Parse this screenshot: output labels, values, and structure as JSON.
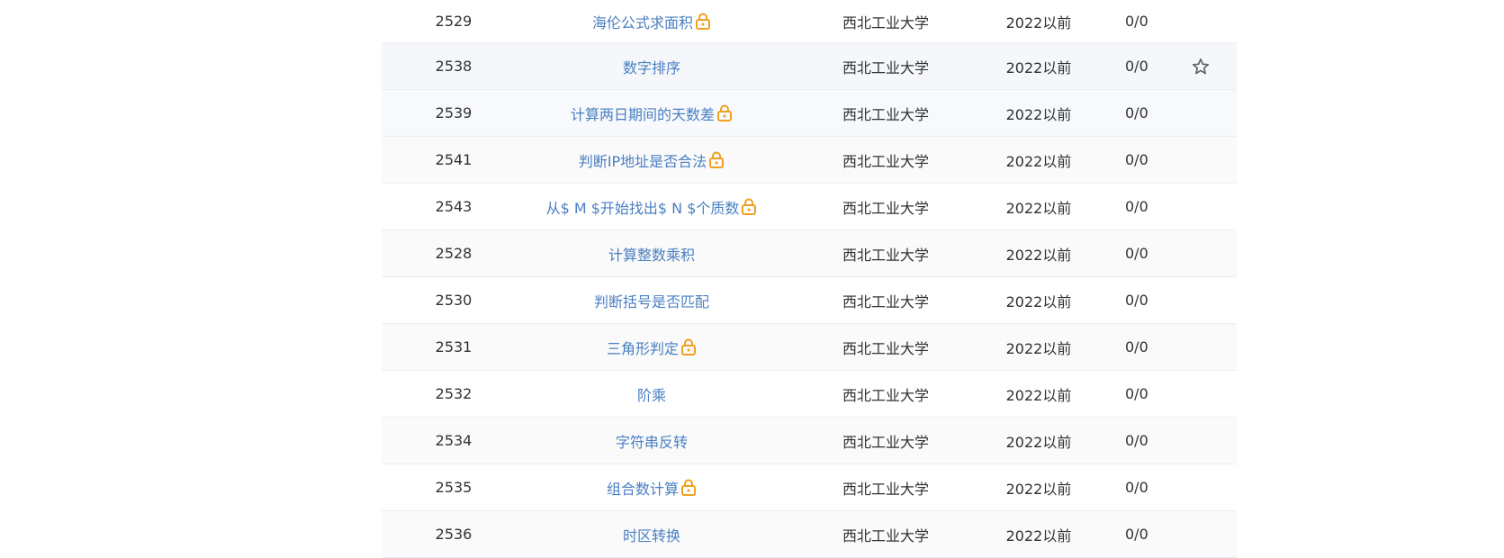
{
  "rows": [
    {
      "id": "2529",
      "title": "海伦公式求面积",
      "locked": true,
      "source": "西北工业大学",
      "year": "2022以前",
      "ratio": "0/0"
    },
    {
      "id": "2538",
      "title": "数字排序",
      "locked": false,
      "source": "西北工业大学",
      "year": "2022以前",
      "ratio": "0/0",
      "star": true
    },
    {
      "id": "2539",
      "title": "计算两日期间的天数差",
      "locked": true,
      "source": "西北工业大学",
      "year": "2022以前",
      "ratio": "0/0"
    },
    {
      "id": "2541",
      "title": "判断IP地址是否合法",
      "locked": true,
      "source": "西北工业大学",
      "year": "2022以前",
      "ratio": "0/0"
    },
    {
      "id": "2543",
      "title": "从$ M $开始找出$ N $个质数",
      "locked": true,
      "source": "西北工业大学",
      "year": "2022以前",
      "ratio": "0/0"
    },
    {
      "id": "2528",
      "title": "计算整数乘积",
      "locked": false,
      "source": "西北工业大学",
      "year": "2022以前",
      "ratio": "0/0"
    },
    {
      "id": "2530",
      "title": "判断括号是否匹配",
      "locked": false,
      "source": "西北工业大学",
      "year": "2022以前",
      "ratio": "0/0"
    },
    {
      "id": "2531",
      "title": "三角形判定",
      "locked": true,
      "source": "西北工业大学",
      "year": "2022以前",
      "ratio": "0/0"
    },
    {
      "id": "2532",
      "title": "阶乘",
      "locked": false,
      "source": "西北工业大学",
      "year": "2022以前",
      "ratio": "0/0"
    },
    {
      "id": "2534",
      "title": "字符串反转",
      "locked": false,
      "source": "西北工业大学",
      "year": "2022以前",
      "ratio": "0/0"
    },
    {
      "id": "2535",
      "title": "组合数计算",
      "locked": true,
      "source": "西北工业大学",
      "year": "2022以前",
      "ratio": "0/0"
    },
    {
      "id": "2536",
      "title": "时区转换",
      "locked": false,
      "source": "西北工业大学",
      "year": "2022以前",
      "ratio": "0/0"
    }
  ],
  "colors": {
    "link": "#4a7fc1",
    "text": "#303133",
    "lock": "#f0a020",
    "star": "#606266",
    "row_alt": "#fafafa",
    "border": "#ebeef5"
  },
  "icons": {
    "lock": "lock-icon",
    "star": "star-outline-icon"
  }
}
